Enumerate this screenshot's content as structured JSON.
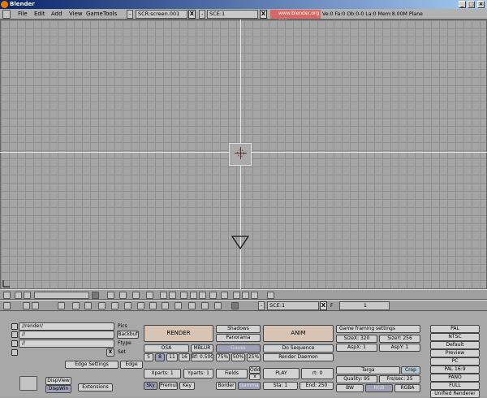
{
  "window": {
    "title": "Blender",
    "min_icon": "minimize-icon",
    "max_icon": "maximize-icon",
    "close_icon": "close-icon"
  },
  "menu": {
    "items": [
      "File",
      "Edit",
      "Add",
      "View",
      "Game",
      "Tools"
    ]
  },
  "header": {
    "screen": "SCR:screen.001",
    "scene": "SCE:1",
    "url": "www.blender.org 228",
    "stats": "Ve:0 Fa:0 Ob:0-0 La:0 Mem:8.00M Plane"
  },
  "bottom_header": {
    "scene": "SCE:1",
    "frame": "1",
    "f_label": "F"
  },
  "render_panel": {
    "paths": [
      "//render/",
      "//",
      "//"
    ],
    "pics_label": "Pics",
    "backbuf_label": "Backbuf",
    "ftype_label": "Ftype",
    "set_label": "Set",
    "x_label": "X",
    "edge_settings": "Edge Settings",
    "edge": "Edge",
    "dispview": "DispView",
    "dispwin": "DispWin",
    "extensions": "Extensions",
    "render": "RENDER",
    "shadows": "Shadows",
    "panorama": "Panorama",
    "osa": "OSA",
    "mblur": "MBLUR",
    "gauss": "Gauss",
    "osa_levels": [
      "5",
      "8",
      "11",
      "16"
    ],
    "bf": "Bf: 0.500",
    "percents": [
      "75%",
      "50%",
      "25%"
    ],
    "xparts": "Xparts: 1",
    "yparts": "Yparts: 1",
    "fields": "Fields",
    "odd": "Odd",
    "x": "x",
    "sky": "Sky",
    "premul": "Premul",
    "key": "Key",
    "border": "Border",
    "gamma": "Gamma",
    "anim": "ANIM",
    "do_sequence": "Do Sequence",
    "render_daemon": "Render Daemon",
    "play": "PLAY",
    "rt": "rt: 0",
    "sta": "Sta: 1",
    "end": "End: 250",
    "game_framing": "Game framing settings",
    "sizex": "SizeX: 320",
    "sizey": "SizeY: 256",
    "aspx": "AspX: 1",
    "aspy": "AspY: 1",
    "format": "Targa",
    "crop": "Crop",
    "quality": "Quality: 95",
    "frs": "Frs/sec: 25",
    "bw": "BW",
    "rgb": "RGB",
    "rgba": "RGBA",
    "presets": [
      "PAL",
      "NTSC",
      "Default",
      "Preview",
      "PC",
      "PAL 16:9",
      "PANO",
      "FULL",
      "Unified Renderer"
    ]
  }
}
